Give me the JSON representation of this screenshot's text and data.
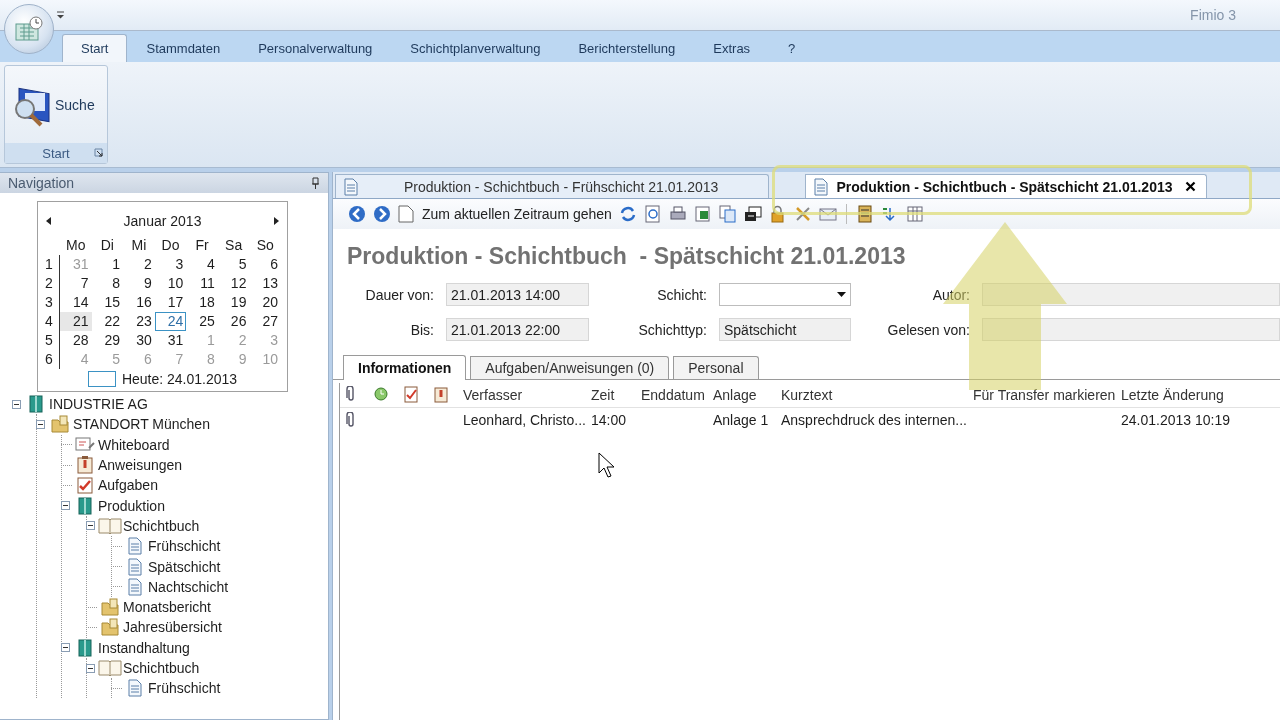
{
  "window": {
    "title": "Fimio 3"
  },
  "ribbon": {
    "tabs": [
      {
        "label": "Start",
        "selected": true
      },
      {
        "label": "Stammdaten",
        "selected": false
      },
      {
        "label": "Personalverwaltung",
        "selected": false
      },
      {
        "label": "Schichtplanverwaltung",
        "selected": false
      },
      {
        "label": "Berichterstellung",
        "selected": false
      },
      {
        "label": "Extras",
        "selected": false
      },
      {
        "label": "?",
        "selected": false
      }
    ],
    "group": {
      "label": "Start",
      "button": "Suche"
    }
  },
  "navigation": {
    "title": "Navigation",
    "calendar": {
      "month": "Januar 2013",
      "weekdays": [
        "Mo",
        "Di",
        "Mi",
        "Do",
        "Fr",
        "Sa",
        "So"
      ],
      "weeks": [
        {
          "number": "1",
          "days": [
            {
              "label": "31",
              "other_month": true,
              "selected": false,
              "today": false
            },
            {
              "label": "1",
              "other_month": false,
              "selected": false,
              "today": false
            },
            {
              "label": "2",
              "other_month": false,
              "selected": false,
              "today": false
            },
            {
              "label": "3",
              "other_month": false,
              "selected": false,
              "today": false
            },
            {
              "label": "4",
              "other_month": false,
              "selected": false,
              "today": false
            },
            {
              "label": "5",
              "other_month": false,
              "selected": false,
              "today": false
            },
            {
              "label": "6",
              "other_month": false,
              "selected": false,
              "today": false
            }
          ]
        },
        {
          "number": "2",
          "days": [
            {
              "label": "7",
              "other_month": false,
              "selected": false,
              "today": false
            },
            {
              "label": "8",
              "other_month": false,
              "selected": false,
              "today": false
            },
            {
              "label": "9",
              "other_month": false,
              "selected": false,
              "today": false
            },
            {
              "label": "10",
              "other_month": false,
              "selected": false,
              "today": false
            },
            {
              "label": "11",
              "other_month": false,
              "selected": false,
              "today": false
            },
            {
              "label": "12",
              "other_month": false,
              "selected": false,
              "today": false
            },
            {
              "label": "13",
              "other_month": false,
              "selected": false,
              "today": false
            }
          ]
        },
        {
          "number": "3",
          "days": [
            {
              "label": "14",
              "other_month": false,
              "selected": false,
              "today": false
            },
            {
              "label": "15",
              "other_month": false,
              "selected": false,
              "today": false
            },
            {
              "label": "16",
              "other_month": false,
              "selected": false,
              "today": false
            },
            {
              "label": "17",
              "other_month": false,
              "selected": false,
              "today": false
            },
            {
              "label": "18",
              "other_month": false,
              "selected": false,
              "today": false
            },
            {
              "label": "19",
              "other_month": false,
              "selected": false,
              "today": false
            },
            {
              "label": "20",
              "other_month": false,
              "selected": false,
              "today": false
            }
          ]
        },
        {
          "number": "4",
          "days": [
            {
              "label": "21",
              "other_month": false,
              "selected": true,
              "today": false
            },
            {
              "label": "22",
              "other_month": false,
              "selected": false,
              "today": false
            },
            {
              "label": "23",
              "other_month": false,
              "selected": false,
              "today": false
            },
            {
              "label": "24",
              "other_month": false,
              "selected": false,
              "today": true
            },
            {
              "label": "25",
              "other_month": false,
              "selected": false,
              "today": false
            },
            {
              "label": "26",
              "other_month": false,
              "selected": false,
              "today": false
            },
            {
              "label": "27",
              "other_month": false,
              "selected": false,
              "today": false
            }
          ]
        },
        {
          "number": "5",
          "days": [
            {
              "label": "28",
              "other_month": false,
              "selected": false,
              "today": false
            },
            {
              "label": "29",
              "other_month": false,
              "selected": false,
              "today": false
            },
            {
              "label": "30",
              "other_month": false,
              "selected": false,
              "today": false
            },
            {
              "label": "31",
              "other_month": false,
              "selected": false,
              "today": false
            },
            {
              "label": "1",
              "other_month": true,
              "selected": false,
              "today": false
            },
            {
              "label": "2",
              "other_month": true,
              "selected": false,
              "today": false
            },
            {
              "label": "3",
              "other_month": true,
              "selected": false,
              "today": false
            }
          ]
        },
        {
          "number": "6",
          "days": [
            {
              "label": "4",
              "other_month": true,
              "selected": false,
              "today": false
            },
            {
              "label": "5",
              "other_month": true,
              "selected": false,
              "today": false
            },
            {
              "label": "6",
              "other_month": true,
              "selected": false,
              "today": false
            },
            {
              "label": "7",
              "other_month": true,
              "selected": false,
              "today": false
            },
            {
              "label": "8",
              "other_month": true,
              "selected": false,
              "today": false
            },
            {
              "label": "9",
              "other_month": true,
              "selected": false,
              "today": false
            },
            {
              "label": "10",
              "other_month": true,
              "selected": false,
              "today": false
            }
          ]
        }
      ],
      "today_label": "Heute: 24.01.2013"
    },
    "tree": [
      {
        "label": "INDUSTRIE AG",
        "kind": "binder",
        "expanded": true,
        "children": [
          {
            "label": "STANDORT München",
            "kind": "folder",
            "expanded": true,
            "children": [
              {
                "label": "Whiteboard",
                "kind": "board"
              },
              {
                "label": "Anweisungen",
                "kind": "clipboard"
              },
              {
                "label": "Aufgaben",
                "kind": "checklist"
              },
              {
                "label": "Produktion",
                "kind": "binder",
                "expanded": true,
                "children": [
                  {
                    "label": "Schichtbuch",
                    "kind": "book",
                    "expanded": true,
                    "children": [
                      {
                        "label": "Frühschicht",
                        "kind": "document"
                      },
                      {
                        "label": "Spätschicht",
                        "kind": "document"
                      },
                      {
                        "label": "Nachtschicht",
                        "kind": "document"
                      }
                    ]
                  },
                  {
                    "label": "Monatsbericht",
                    "kind": "folder"
                  },
                  {
                    "label": "Jahresübersicht",
                    "kind": "folder"
                  }
                ]
              },
              {
                "label": "Instandhaltung",
                "kind": "binder",
                "expanded": true,
                "children": [
                  {
                    "label": "Schichtbuch",
                    "kind": "book",
                    "expanded": true,
                    "children": [
                      {
                        "label": "Frühschicht",
                        "kind": "document"
                      }
                    ]
                  }
                ]
              }
            ]
          }
        ]
      }
    ]
  },
  "documents": {
    "tabs": [
      {
        "label": "Produktion - Schichtbuch  - Frühschicht 21.01.2013",
        "selected": false
      },
      {
        "label": "Produktion - Schichtbuch  - Spätschicht 21.01.2013",
        "selected": true
      }
    ],
    "toolbar": {
      "goto_label": "Zum aktuellen Zeitraum gehen"
    },
    "heading": "Produktion - Schichtbuch  - Spätschicht 21.01.2013",
    "fields": [
      {
        "label": "Dauer von:",
        "kind": "text",
        "value": "21.01.2013 14:00"
      },
      {
        "label": "Schicht:",
        "kind": "dropdown"
      },
      {
        "label": "Autor:",
        "kind": "text"
      },
      {
        "label": "Bis:",
        "kind": "text",
        "value": "21.01.2013 22:00"
      },
      {
        "label": "Schichttyp:",
        "kind": "text",
        "value": "Spätschicht"
      },
      {
        "label": "Gelesen von:",
        "kind": "text"
      }
    ],
    "inner_tabs": [
      {
        "label": "Informationen",
        "selected": true
      },
      {
        "label": "Aufgaben/Anweisungen (0)",
        "selected": false
      },
      {
        "label": "Personal",
        "selected": false
      }
    ],
    "table": {
      "columns": [
        "Verfasser",
        "Zeit",
        "Enddatum",
        "Anlage",
        "Kurztext",
        "Für Transfer markieren",
        "Letzte Änderung"
      ],
      "rows": [
        {
          "attachment": true,
          "cells": [
            "Leonhard, Christo...",
            "14:00",
            "",
            "Anlage 1",
            "Ansprechdruck des internen...",
            "",
            "24.01.2013 10:19"
          ]
        }
      ]
    }
  }
}
